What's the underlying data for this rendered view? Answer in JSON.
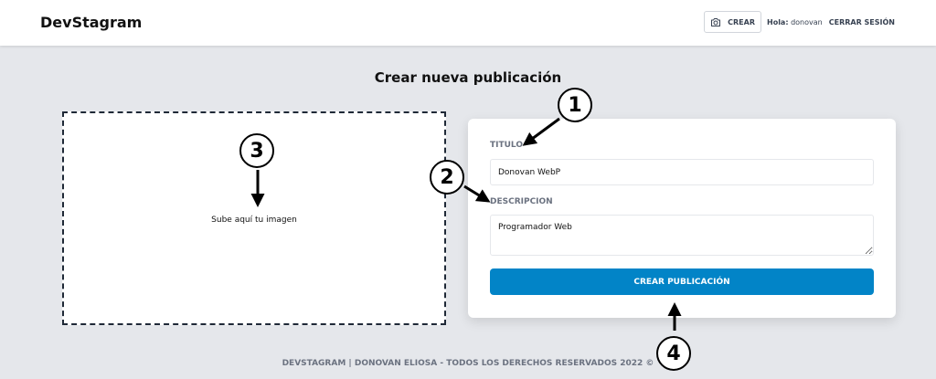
{
  "header": {
    "brand": "DevStagram",
    "crear_label": "CREAR",
    "greeting_label": "Hola:",
    "username": "donovan",
    "logout_label": "CERRAR SESIÓN"
  },
  "main": {
    "title": "Crear nueva publicación",
    "dropzone_text": "Sube aquí tu imagen"
  },
  "form": {
    "titulo_label": "TITULO",
    "titulo_value": "Donovan WebP",
    "descripcion_label": "DESCRIPCION",
    "descripcion_value": "Programador Web",
    "submit_label": "CREAR PUBLICACIÓN"
  },
  "footer": {
    "text": "DEVSTAGRAM | DONOVAN ELIOSA - TODOS LOS DERECHOS RESERVADOS 2022 ©"
  },
  "annotations": [
    "1",
    "2",
    "3",
    "4"
  ],
  "icons": {
    "crear": "camera-icon"
  },
  "colors": {
    "primary": "#0284c7",
    "background": "#e5e7eb"
  }
}
